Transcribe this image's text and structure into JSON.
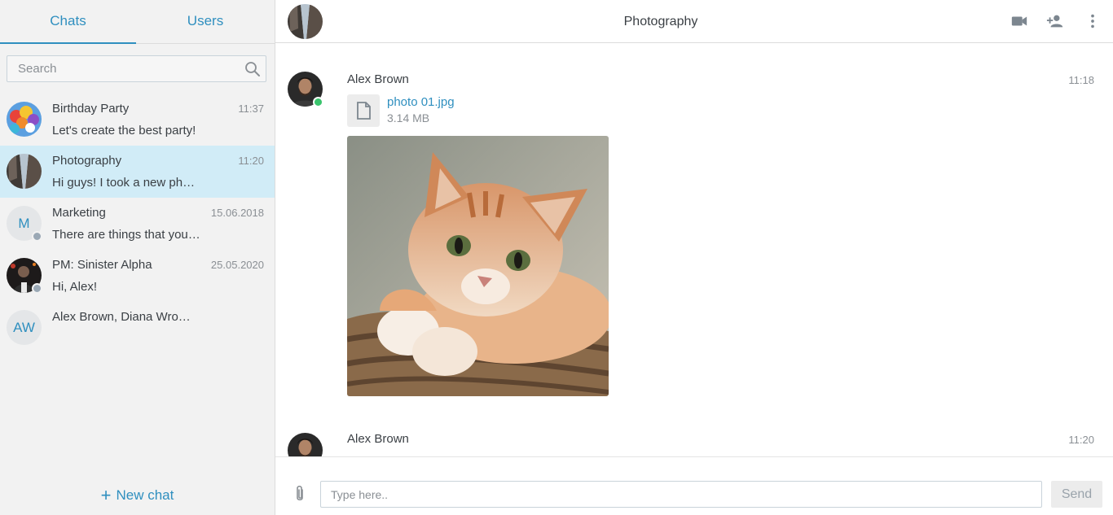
{
  "sidebar": {
    "tabs": [
      {
        "label": "Chats",
        "active": true
      },
      {
        "label": "Users",
        "active": false
      }
    ],
    "search": {
      "placeholder": "Search",
      "value": ""
    },
    "chats": [
      {
        "name": "Birthday Party",
        "time": "11:37",
        "preview": "Let's create the best party!",
        "avatar": "balloons-image",
        "active": false,
        "status": "none"
      },
      {
        "name": "Photography",
        "time": "11:20",
        "preview": "Hi guys! I took a new photo!",
        "avatar": "buildings-image",
        "active": true,
        "status": "none"
      },
      {
        "name": "Marketing",
        "time": "15.06.2018",
        "preview": "There are things that you need to know",
        "avatar_initials": "M",
        "active": false,
        "status": "offline"
      },
      {
        "name": "PM: Sinister Alpha",
        "time": "25.05.2020",
        "preview": "Hi, Alex!",
        "avatar": "person-dark-image",
        "active": false,
        "status": "offline"
      },
      {
        "name": "Alex Brown, Diana Wrongs",
        "time": "",
        "preview": "",
        "avatar_initials": "AW",
        "active": false,
        "status": "none"
      }
    ],
    "new_chat_label": "New chat"
  },
  "header": {
    "title": "Photography",
    "icons": [
      "video-camera-icon",
      "add-user-icon",
      "more-vertical-icon"
    ]
  },
  "messages": [
    {
      "author": "Alex Brown",
      "time": "11:18",
      "online": true,
      "attachment": {
        "file_name": "photo 01.jpg",
        "file_size": "3.14 MB",
        "icon": "file-icon",
        "image": "ginger-cat-photo"
      }
    },
    {
      "author": "Alex Brown",
      "time": "11:20",
      "online": false
    }
  ],
  "composer": {
    "placeholder": "Type here..",
    "value": "",
    "send_label": "Send",
    "attach_icon": "paperclip-icon"
  },
  "colors": {
    "accent": "#2f8fbf",
    "active_chat_bg": "#d1ecf7",
    "sidebar_bg": "#f2f2f2",
    "online": "#3ac46d",
    "offline": "#9aa8b5"
  }
}
